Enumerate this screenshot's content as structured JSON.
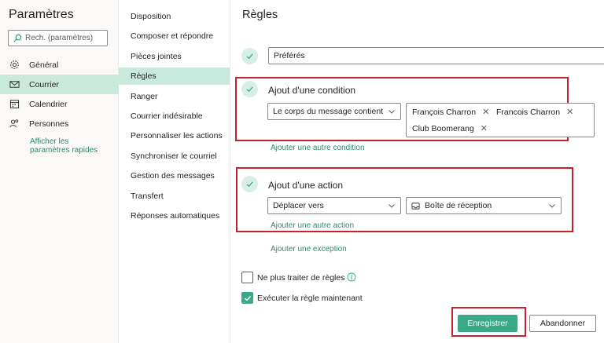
{
  "left": {
    "title": "Paramètres",
    "search_placeholder": "Rech. (paramètres)",
    "nav": [
      {
        "label": "Général",
        "icon": "gear-icon"
      },
      {
        "label": "Courrier",
        "icon": "mail-icon"
      },
      {
        "label": "Calendrier",
        "icon": "calendar-icon"
      },
      {
        "label": "Personnes",
        "icon": "people-icon"
      }
    ],
    "quick_settings": "Afficher les paramètres rapides"
  },
  "middle": {
    "items": [
      "Disposition",
      "Composer et répondre",
      "Pièces jointes",
      "Règles",
      "Ranger",
      "Courrier indésirable",
      "Personnaliser les actions",
      "Synchroniser le courriel",
      "Gestion des messages",
      "Transfert",
      "Réponses automatiques"
    ]
  },
  "main": {
    "title": "Règles",
    "rule_name": "Préférés",
    "condition": {
      "title": "Ajout d'une condition",
      "dropdown": "Le corps du message contient",
      "tags": [
        "François Charron",
        "Francois Charron",
        "Club Boomerang"
      ],
      "add_link": "Ajouter une autre condition"
    },
    "action": {
      "title": "Ajout d'une action",
      "dropdown": "Déplacer vers",
      "folder": "Boîte de réception",
      "add_link": "Ajouter une autre action"
    },
    "exception_link": "Ajouter une exception",
    "stop_processing": {
      "label": "Ne plus traiter de règles",
      "checked": false
    },
    "run_now": {
      "label": "Exécuter la règle maintenant",
      "checked": true
    },
    "save_label": "Enregistrer",
    "cancel_label": "Abandonner"
  },
  "colors": {
    "accent": "#3aa987",
    "active_bg": "#c8e9dc",
    "highlight": "#c8202c",
    "link": "#2e8b6f"
  }
}
